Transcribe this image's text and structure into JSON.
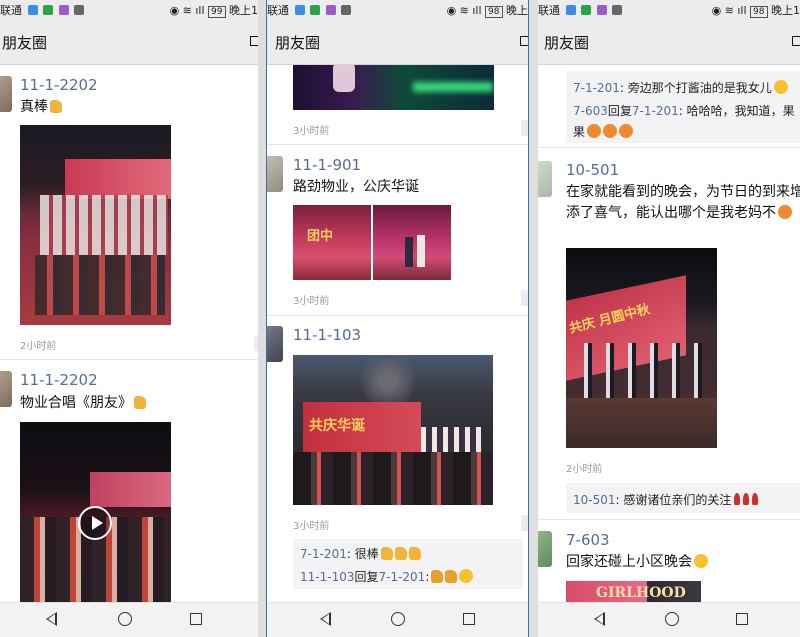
{
  "status": {
    "carrier": "联通",
    "battery_left": "99",
    "battery_mid": "98",
    "battery_right": "98",
    "time_left": "晚上1",
    "time_mid": "晚上",
    "time_right": "晚上1"
  },
  "nav": {
    "title": "朋友圈"
  },
  "colors": {
    "link": "#576b95",
    "bg": "#ffffff",
    "navbar": "#ececec",
    "comment_bg": "#f3f3f5"
  },
  "panel1": {
    "post1": {
      "name": "11-1-2202",
      "text": "真棒",
      "time": "2小时前"
    },
    "post2": {
      "name": "11-1-2202",
      "text": "物业合唱《朋友》"
    }
  },
  "panel2": {
    "post0": {
      "time": "3小时前"
    },
    "post1": {
      "name": "11-1-901",
      "text": "路劲物业，公庆华诞",
      "time": "3小时前"
    },
    "post2": {
      "name": "11-1-103",
      "time": "3小时前",
      "banner": "共庆华诞"
    },
    "comments": [
      {
        "name": "7-1-201",
        "text": ": 很棒"
      },
      {
        "name": "11-1-103",
        "reply_word": "回复",
        "target": "7-1-201",
        "text": ":"
      }
    ]
  },
  "panel3": {
    "top_comments": [
      {
        "name": "7-1-201",
        "text": ": 旁边那个打酱油的是我女儿"
      },
      {
        "name": "7-603",
        "reply_word": "回复",
        "target": "7-1-201",
        "text": ": 哈哈哈，我知道，果",
        "text2": "果"
      }
    ],
    "post1": {
      "name": "10-501",
      "text": "在家就能看到的晚会，为节日的到来增添了喜气，能认出哪个是我老妈不",
      "time": "2小时前",
      "banner": "共庆 月圆中秋"
    },
    "comment": {
      "name": "10-501",
      "text": ": 感谢诸位亲们的关注"
    },
    "post2": {
      "name": "7-603",
      "text": "回家还碰上小区晚会",
      "sign": "GIRLHOOD"
    }
  }
}
